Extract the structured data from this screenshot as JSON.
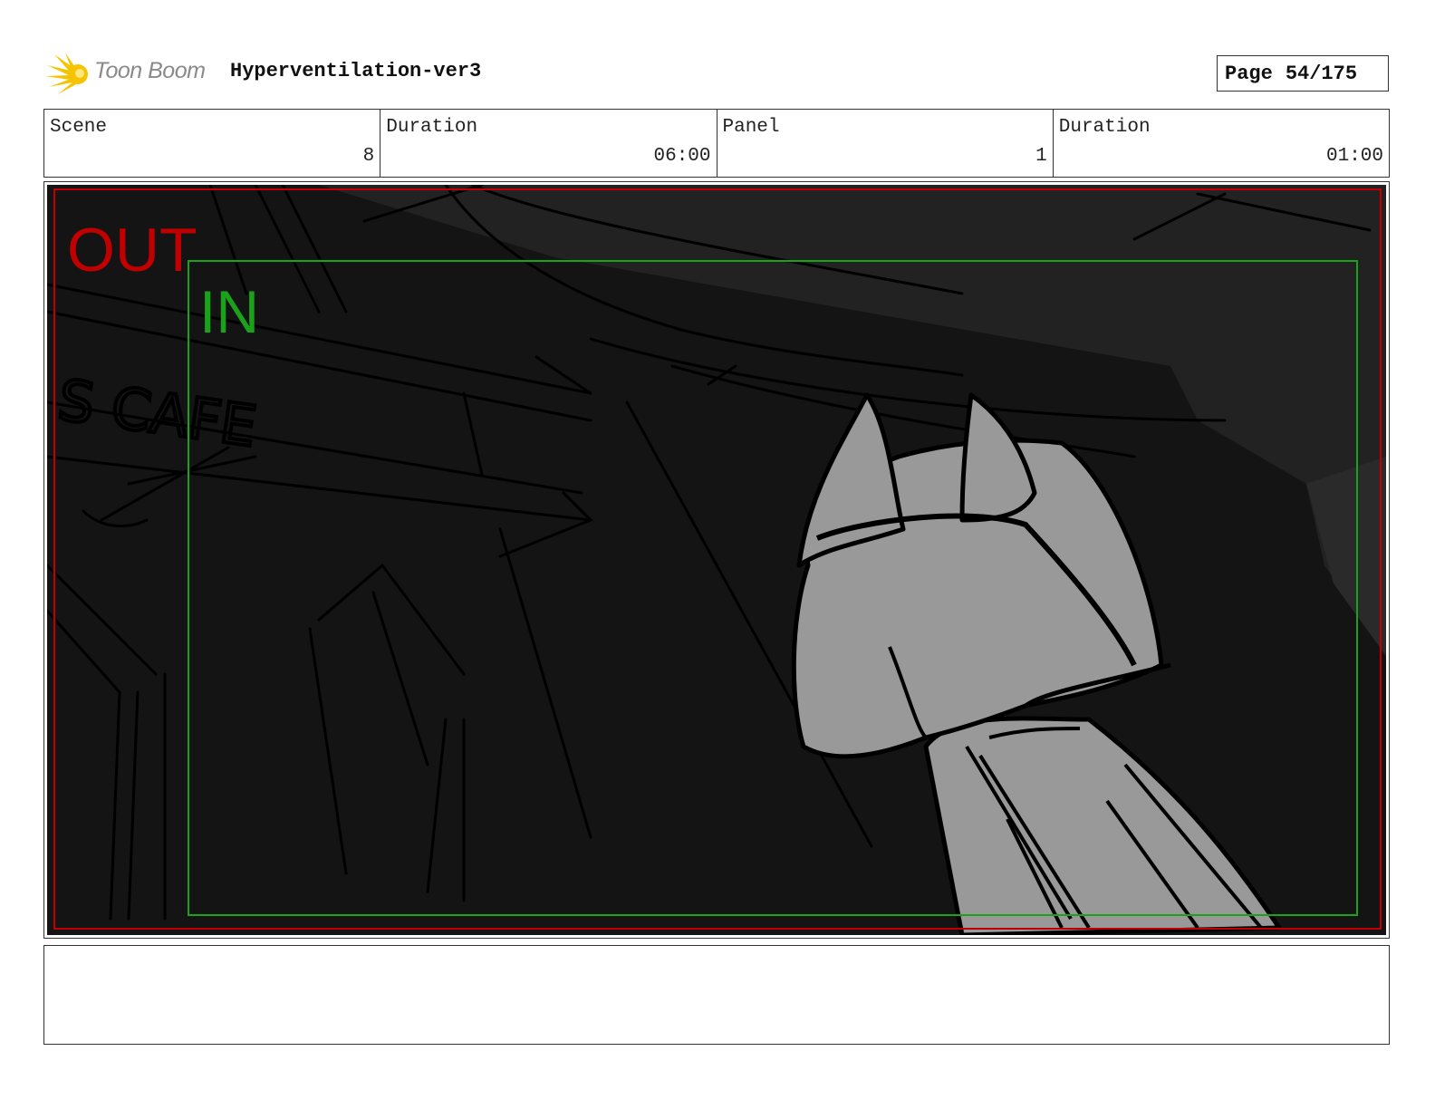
{
  "header": {
    "logo_text": "Toon Boom",
    "project_title": "Hyperventilation-ver3",
    "page_label": "Page",
    "page_number": "54/175"
  },
  "info": {
    "scene_label": "Scene",
    "scene_value": "8",
    "scene_duration_label": "Duration",
    "scene_duration_value": "06:00",
    "panel_label": "Panel",
    "panel_value": "1",
    "panel_duration_label": "Duration",
    "panel_duration_value": "01:00"
  },
  "panel": {
    "out_label": "OUT",
    "in_label": "IN",
    "sign_text": "S CAFE",
    "out_color": "#c00000",
    "in_color": "#1aa31a"
  },
  "notes": {
    "text": ""
  }
}
